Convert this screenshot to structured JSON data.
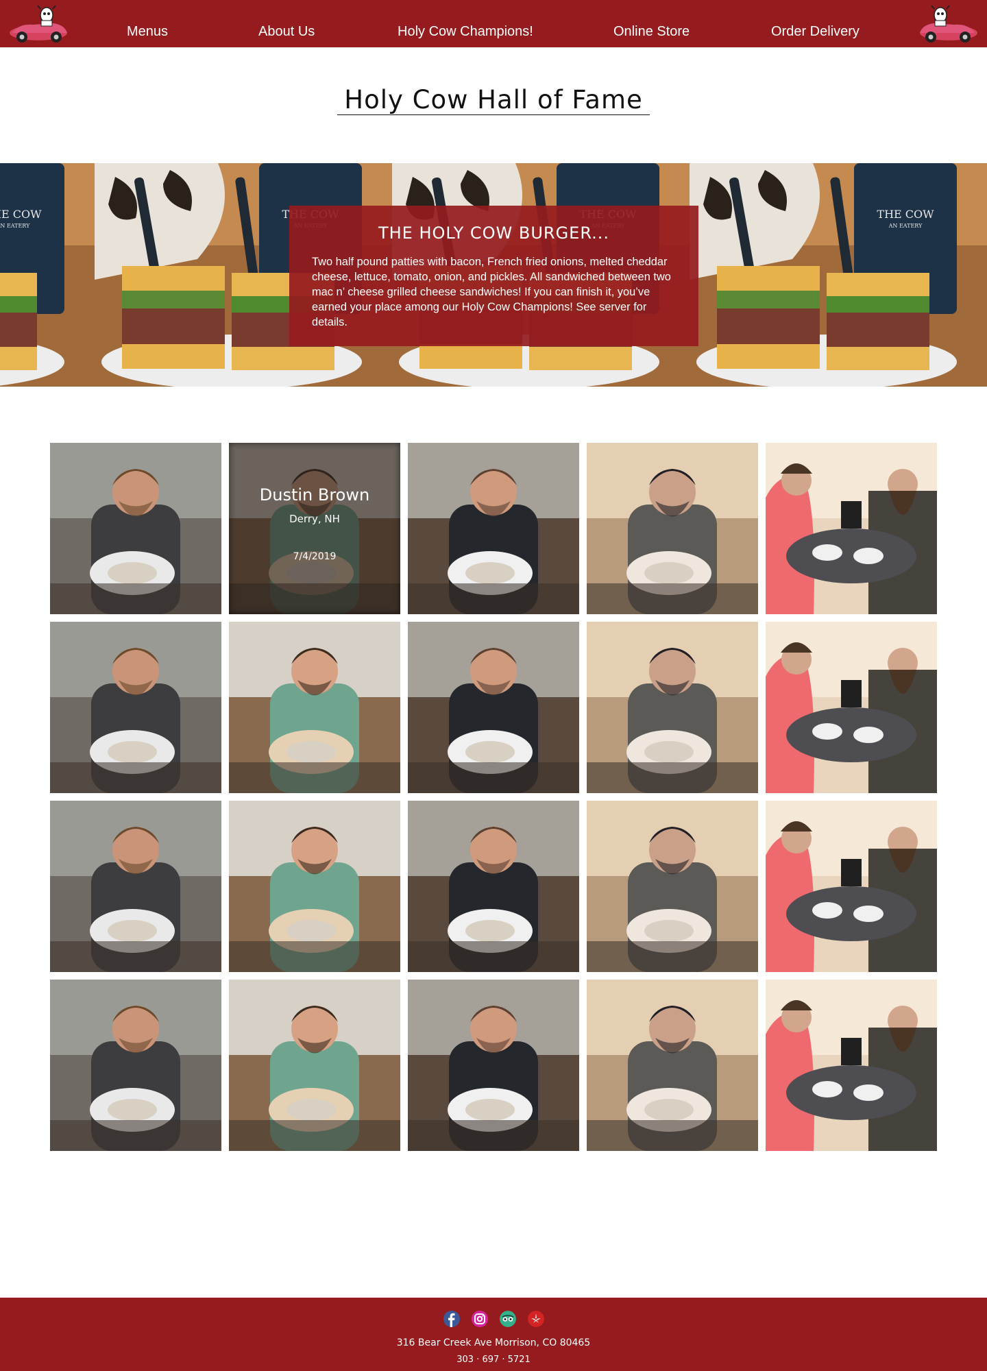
{
  "colors": {
    "brand_red": "#951b1e",
    "hero_card": "#951b1e",
    "text_dark": "#111111"
  },
  "nav": {
    "logo_icon": "car-cow-logo-icon",
    "items": [
      {
        "label": "Menus"
      },
      {
        "label": "About Us"
      },
      {
        "label": "Holy Cow Champions!"
      },
      {
        "label": "Online Store"
      },
      {
        "label": "Order Delivery"
      }
    ]
  },
  "page": {
    "title": "Holy Cow Hall of Fame"
  },
  "hero": {
    "title": "THE HOLY COW BURGER...",
    "description": "Two half pound patties with bacon, French fried onions, melted cheddar cheese, lettuce, tomato, onion, and pickles. All sandwiched between two mac n’ cheese grilled cheese sandwiches! If you can finish it, you’ve earned your place among our Holy Cow Champions! See server for details."
  },
  "gallery": {
    "hover_card": {
      "name": "Dustin Brown",
      "location": "Derry, NH",
      "date": "7/4/2019"
    },
    "photos": [
      "champion-photo-cap-beard",
      "champion-photo-green-shirt",
      "champion-photo-black-shirt",
      "champion-photo-window-seat",
      "champion-photo-couple",
      "champion-photo-cap-beard",
      "champion-photo-green-shirt",
      "champion-photo-black-shirt",
      "champion-photo-window-seat",
      "champion-photo-couple",
      "champion-photo-cap-beard",
      "champion-photo-green-shirt",
      "champion-photo-black-shirt",
      "champion-photo-window-seat",
      "champion-photo-couple",
      "champion-photo-cap-beard",
      "champion-photo-green-shirt",
      "champion-photo-black-shirt",
      "champion-photo-window-seat",
      "champion-photo-couple"
    ]
  },
  "footer": {
    "social_icons": [
      "facebook-icon",
      "instagram-icon",
      "tripadvisor-icon",
      "yelp-icon"
    ],
    "address": "316 Bear Creek Ave Morrison, CO 80465",
    "phone": "303 · 697 · 5721"
  }
}
